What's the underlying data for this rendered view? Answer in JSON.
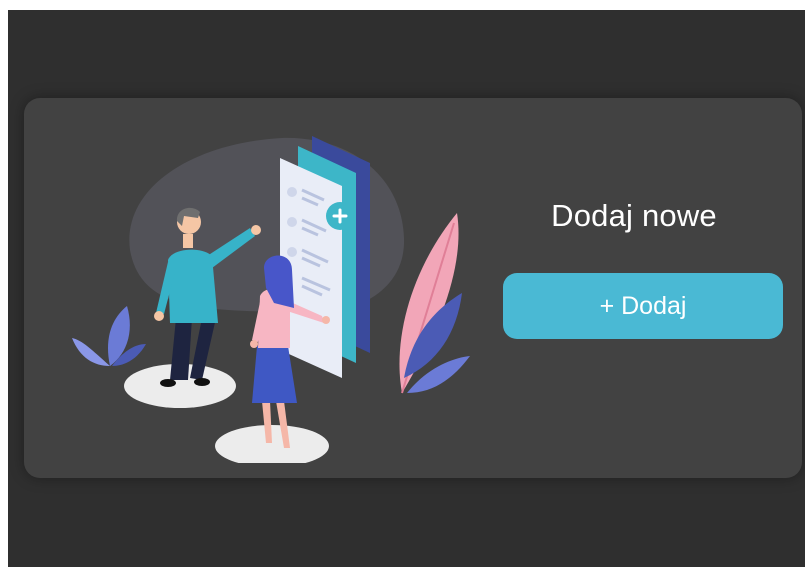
{
  "card": {
    "title": "Dodaj nowe",
    "add_button_label": "+ Dodaj"
  },
  "illustration": {
    "icon": "people-with-documents-illustration"
  },
  "colors": {
    "background": "#2f2f2f",
    "card": "#424242",
    "accent": "#4ab9d4",
    "text": "#ffffff"
  }
}
